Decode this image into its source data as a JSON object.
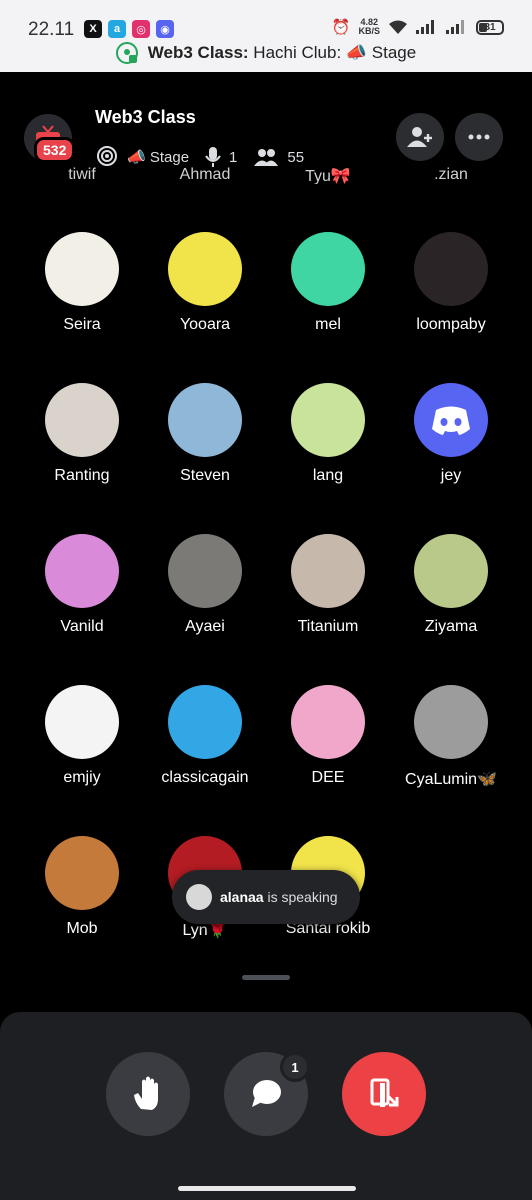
{
  "status_bar": {
    "time": "22.11",
    "net_speed": "4.82\nKB/S",
    "battery": "31",
    "banner_channel": "Web3 Class:",
    "banner_rest": "Hachi Club: 📣 Stage"
  },
  "header": {
    "title": "Web3 Class",
    "notif_count": "532",
    "stage_label": "📣 Stage",
    "speakers": "1",
    "listeners": "55"
  },
  "cut_names": [
    "tiwif",
    "Ahmad",
    "Tyu🎀",
    ".zian"
  ],
  "participants": [
    {
      "name": "Seira",
      "color": "#f2efe6"
    },
    {
      "name": "Yooara",
      "color": "#f1e34a"
    },
    {
      "name": "mel",
      "color": "#3fd6a4"
    },
    {
      "name": "loompaby",
      "color": "#2a2426"
    },
    {
      "name": "Ranting",
      "color": "#d9d3cc"
    },
    {
      "name": "Steven",
      "color": "#8fb8d8"
    },
    {
      "name": "lang",
      "color": "#c9e39a"
    },
    {
      "name": "jey",
      "color": "#5865f2"
    },
    {
      "name": "Vanild",
      "color": "#d98bd9"
    },
    {
      "name": "Ayaei",
      "color": "#7c7a76"
    },
    {
      "name": "Titanium",
      "color": "#c6b9ab"
    },
    {
      "name": "Ziyama",
      "color": "#b9c98a"
    },
    {
      "name": "emjiy",
      "color": "#f4f4f4"
    },
    {
      "name": "classicagain",
      "color": "#33a6e6"
    },
    {
      "name": "DEE",
      "color": "#f1a7c9"
    },
    {
      "name": "CyaLumin🦋",
      "color": "#9c9c9c"
    },
    {
      "name": "Mob",
      "color": "#c47a3a"
    },
    {
      "name": "Lyn🌹",
      "color": "#b31c22"
    },
    {
      "name": "Santai rokib",
      "color": "#f1e34a"
    }
  ],
  "toast": {
    "user": "alanaa",
    "text": "is speaking"
  },
  "controls": {
    "chat_badge": "1"
  },
  "colors": {
    "background": "#000000",
    "panel": "#1e1f22",
    "leave_red": "#ed4245",
    "discord_blurple": "#5865f2",
    "badge_red": "#e8434b"
  }
}
